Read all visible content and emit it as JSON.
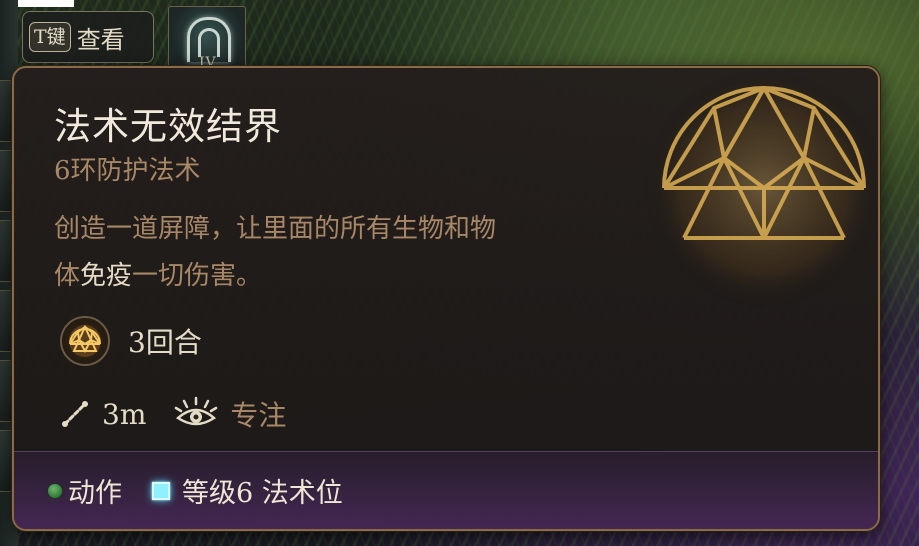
{
  "hud": {
    "key_hint": {
      "key": "T键",
      "label": "查看"
    },
    "hotbar_slot_tier": "IV"
  },
  "tooltip": {
    "title": "法术无效结界",
    "subtitle": "6环防护法术",
    "description": {
      "line1": "创造一道屏障，让里面的所有生物和物",
      "line2_prefix": "体",
      "line2_highlight": "免疫",
      "line2_suffix": "一切伤害。"
    },
    "duration": "3回合",
    "range": "3m",
    "concentration": "专注",
    "footer": {
      "action": "动作",
      "slot": "等级6 法术位"
    }
  },
  "colors": {
    "title": "#f1e9dc",
    "muted_text": "#a88767",
    "border": "#8b6a46",
    "action_green": "#2f7a33",
    "spell_slot_blue": "#8ff0ff",
    "footer_purple": "#46285a"
  },
  "icons": [
    "gear-icon",
    "dome-icon",
    "range-icon",
    "concentration-eye-icon",
    "action-dot-icon",
    "spell-slot-icon"
  ]
}
